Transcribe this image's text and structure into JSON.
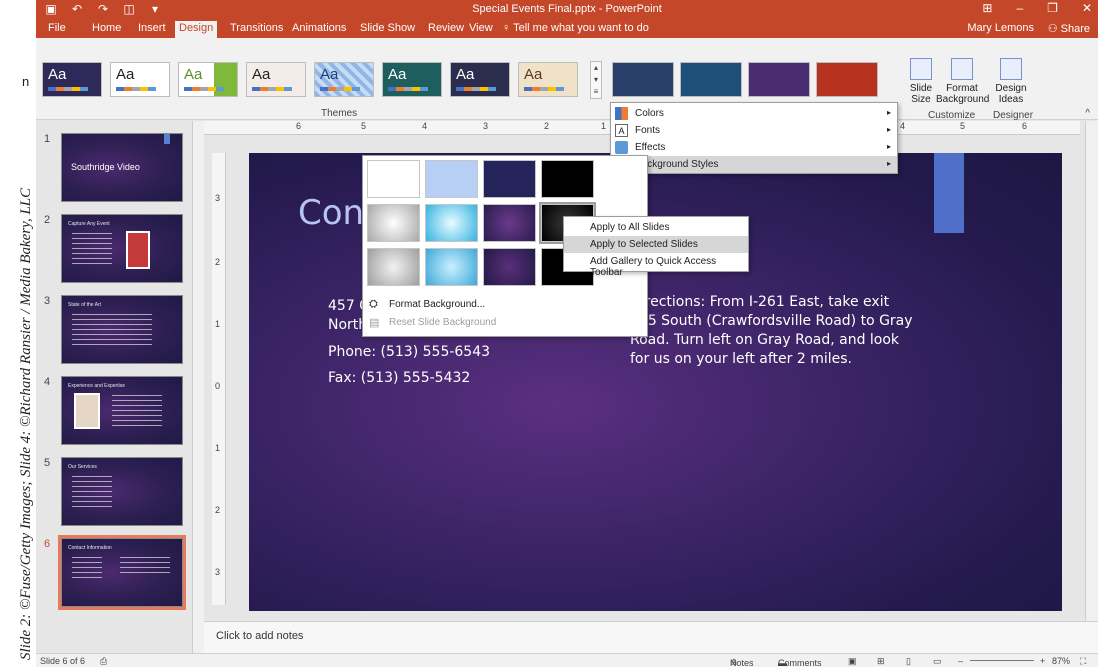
{
  "credit": "Slide 2: ©Fuse/Getty Images; Slide 4: ©Richard Ransier / Media Bakery, LLC",
  "credit_char": "n",
  "window": {
    "title": "Special Events Final.pptx - PowerPoint",
    "user": "Mary Lemons",
    "share": "Share"
  },
  "tabs": [
    "File",
    "Home",
    "Insert",
    "Design",
    "Transitions",
    "Animations",
    "Slide Show",
    "Review",
    "View"
  ],
  "active_tab": "Design",
  "tell_me": "Tell me what you want to do",
  "ribbon": {
    "themes_label": "Themes",
    "theme_sample_text": "Aa",
    "slide_size": "Slide\nSize",
    "format_background": "Format\nBackground",
    "design_ideas": "Design\nIdeas",
    "customize_label": "Customize",
    "designer_label": "Designer"
  },
  "colors": {
    "accent": "#c4472a",
    "slide_bg": "#3b2466",
    "selected_outline": "#e67a5c"
  },
  "variant_menu": {
    "items": [
      {
        "label": "Colors",
        "icon": "colors-icon"
      },
      {
        "label": "Fonts",
        "icon": "fonts-icon"
      },
      {
        "label": "Effects",
        "icon": "effects-icon"
      },
      {
        "label": "Background Styles",
        "icon": "background-styles-icon"
      }
    ]
  },
  "bg_gallery": {
    "format_background": "Format Background...",
    "reset_background": "Reset Slide Background"
  },
  "context_menu": {
    "items": [
      "Apply to All Slides",
      "Apply to Selected Slides",
      "Add Gallery to Quick Access Toolbar"
    ]
  },
  "slides": [
    {
      "num": "1",
      "title": "Southridge Video"
    },
    {
      "num": "2",
      "title": "Capture Any Event"
    },
    {
      "num": "3",
      "title": "State of the Art"
    },
    {
      "num": "4",
      "title": "Experience and Expertise"
    },
    {
      "num": "5",
      "title": "Our Services"
    },
    {
      "num": "6",
      "title": "Contact Information"
    }
  ],
  "slide": {
    "title_partial": "Cont",
    "address_line1": "457 C",
    "address_line2": "North",
    "phone": "Phone: (513) 555-6543",
    "fax": "Fax: (513) 555-5432",
    "directions": "Directions: From I-261 East, take exit 205 South (Crawfordsville Road) to Gray Road. Turn left on Gray Road, and look for us on your left after 2 miles."
  },
  "ruler": {
    "h_ticks": [
      "6",
      "5",
      "4",
      "3",
      "2",
      "1",
      "4",
      "5",
      "6"
    ],
    "v_ticks": [
      "3",
      "2",
      "1",
      "0",
      "1",
      "2",
      "3"
    ]
  },
  "notes": {
    "placeholder": "Click to add notes"
  },
  "status": {
    "slide_info": "Slide 6 of 6",
    "notes": "Notes",
    "comments": "Comments",
    "zoom": "87%"
  }
}
